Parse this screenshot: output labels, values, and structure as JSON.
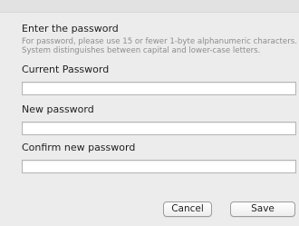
{
  "dialog": {
    "heading": "Enter the password",
    "hint_line1": "For password, please use 15 or fewer 1-byte alphanumeric characters.",
    "hint_line2": "System distinguishes between capital and lower-case letters."
  },
  "fields": {
    "current_password": {
      "label": "Current Password",
      "value": "",
      "placeholder": ""
    },
    "new_password": {
      "label": "New password",
      "value": "",
      "placeholder": ""
    },
    "confirm_password": {
      "label": "Confirm new password",
      "value": "",
      "placeholder": ""
    }
  },
  "buttons": {
    "cancel": "Cancel",
    "save": "Save"
  }
}
